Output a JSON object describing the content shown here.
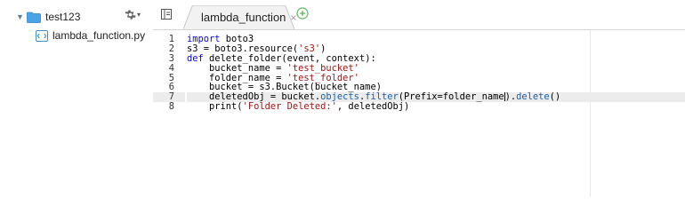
{
  "sidebar": {
    "folder_name": "test123",
    "file_name": "lambda_function.py"
  },
  "tabs": [
    {
      "label": "lambda_function",
      "close": "×"
    }
  ],
  "editor": {
    "line_numbers": [
      "1",
      "2",
      "3",
      "4",
      "5",
      "6",
      "7",
      "8"
    ],
    "active_line": 7,
    "code": [
      "import boto3",
      "s3 = boto3.resource('s3')",
      "def delete_folder(event, context):",
      "    bucket_name = 'test_bucket'",
      "    folder_name = 'test_folder'",
      "    bucket = s3.Bucket(bucket_name)",
      "    deletedObj = bucket.objects.filter(Prefix=folder_name).delete()",
      "    print('Folder Deleted:', deletedObj)"
    ]
  },
  "colors": {
    "folder": "#3b9be0",
    "add_tab": "#4caf50",
    "keyword": "#0000ff",
    "string": "#a31515"
  },
  "icons": {
    "expand": "caret-down-icon",
    "folder": "folder-icon",
    "file": "python-file-icon",
    "settings": "gear-icon",
    "tree_toggle": "file-tree-toggle-icon",
    "close_tab": "close-icon",
    "new_tab": "plus-circle-icon"
  }
}
